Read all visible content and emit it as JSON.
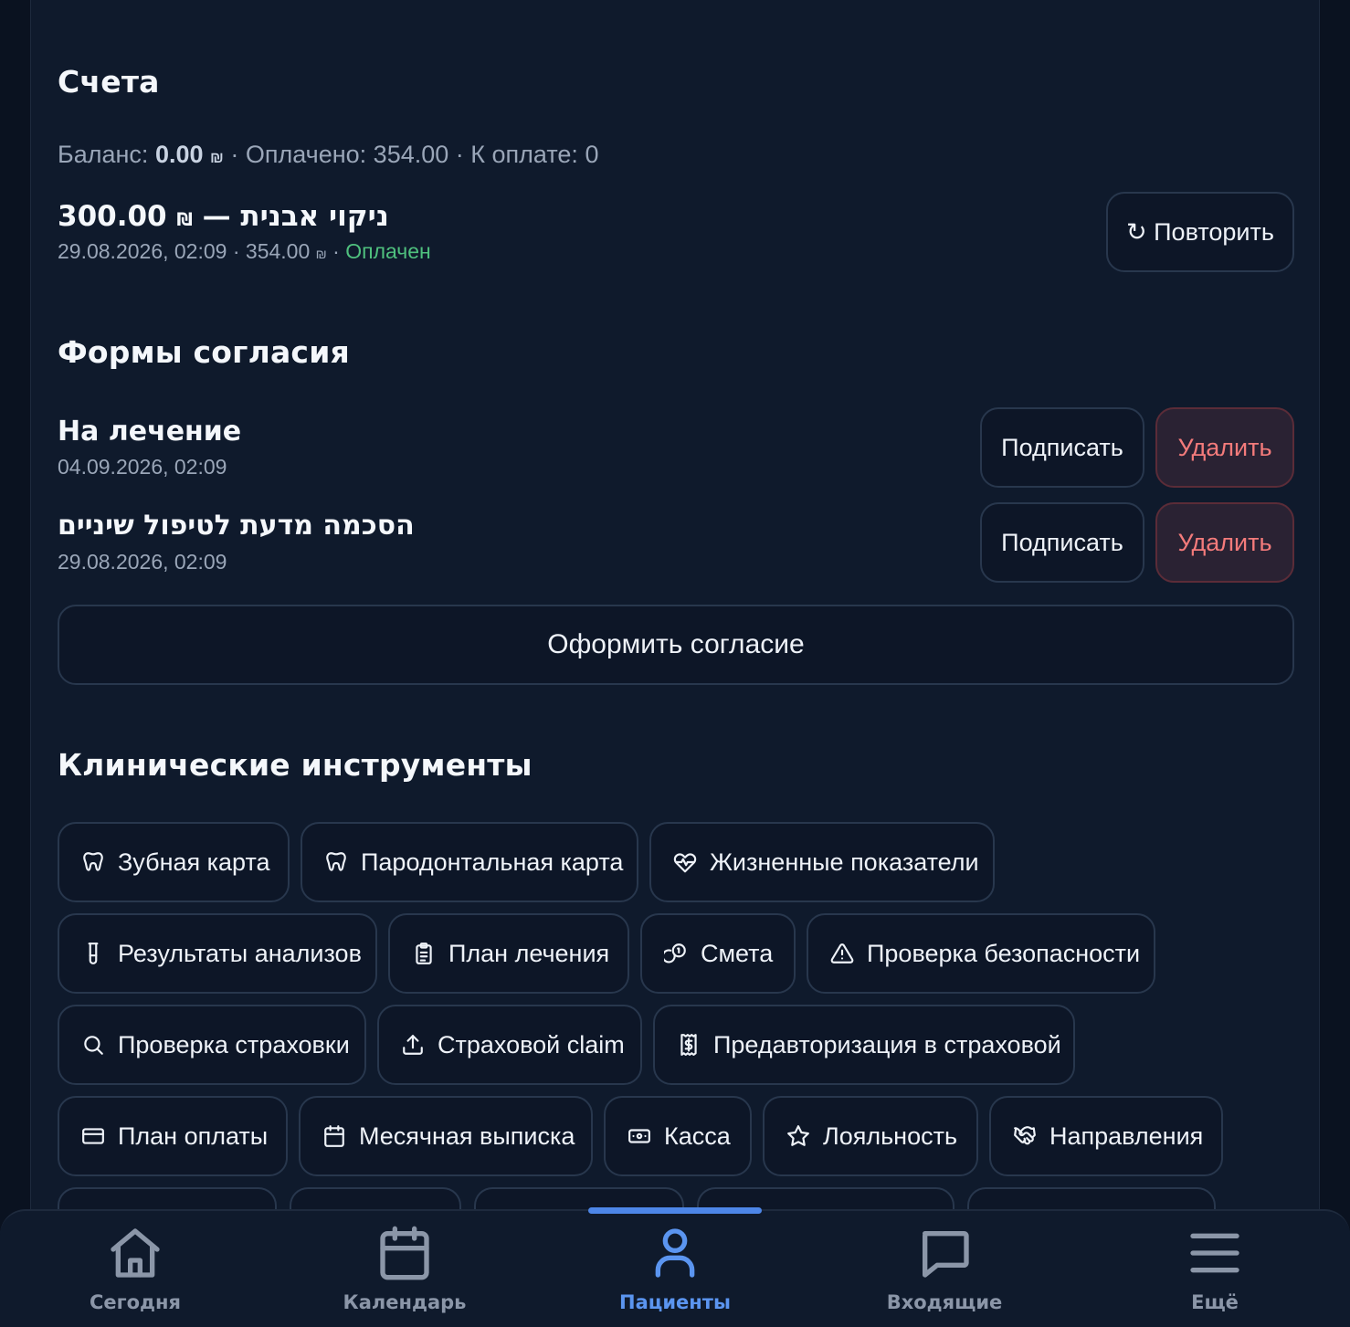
{
  "invoices": {
    "title": "Счета",
    "balance_label": "Баланс:",
    "balance_value": "0.00",
    "paid_label": "Оплачено:",
    "paid_value": "354.00",
    "due_label": "К оплате:",
    "due_value": "0",
    "currency": "₪",
    "separator": "·",
    "item": {
      "amount": "300.00",
      "dash": "—",
      "name": "ניקוי אבנית",
      "date": "29.08.2026, 02:09",
      "paid_amount": "354.00",
      "status": "Оплачен",
      "status_color": "#4fc07e",
      "repeat_label": "↻ Повторить"
    }
  },
  "consents": {
    "title": "Формы согласия",
    "items": [
      {
        "title": "На лечение",
        "date": "04.09.2026, 02:09",
        "sign_label": "Подписать",
        "delete_label": "Удалить"
      },
      {
        "title": "הסכמה מדעת לטיפול שיניים",
        "date": "29.08.2026, 02:09",
        "sign_label": "Подписать",
        "delete_label": "Удалить"
      }
    ],
    "create_label": "Оформить согласие"
  },
  "tools": {
    "title": "Клинические инструменты",
    "items": [
      {
        "label": "Зубная карта",
        "icon": "tooth-icon"
      },
      {
        "label": "Пародонтальная карта",
        "icon": "tooth-icon"
      },
      {
        "label": "Жизненные показатели",
        "icon": "heart-pulse-icon"
      },
      {
        "label": "Результаты анализов",
        "icon": "test-tube-icon"
      },
      {
        "label": "План лечения",
        "icon": "clipboard-list-icon"
      },
      {
        "label": "Смета",
        "icon": "coins-icon"
      },
      {
        "label": "Проверка безопасности",
        "icon": "alert-triangle-icon"
      },
      {
        "label": "Проверка страховки",
        "icon": "search-icon"
      },
      {
        "label": "Страховой claim",
        "icon": "upload-icon"
      },
      {
        "label": "Предавторизация в страховой",
        "icon": "receipt-icon"
      },
      {
        "label": "План оплаты",
        "icon": "credit-card-icon"
      },
      {
        "label": "Месячная выписка",
        "icon": "calendar-icon"
      },
      {
        "label": "Касса",
        "icon": "banknote-icon"
      },
      {
        "label": "Лояльность",
        "icon": "star-icon"
      },
      {
        "label": "Направления",
        "icon": "handshake-icon"
      }
    ]
  },
  "nav": {
    "active_color": "#5b95f0",
    "items": [
      {
        "label": "Сегодня",
        "icon": "home-icon"
      },
      {
        "label": "Календарь",
        "icon": "calendar-icon"
      },
      {
        "label": "Пациенты",
        "icon": "user-icon",
        "active": true
      },
      {
        "label": "Входящие",
        "icon": "message-icon"
      },
      {
        "label": "Ещё",
        "icon": "menu-icon"
      }
    ]
  }
}
